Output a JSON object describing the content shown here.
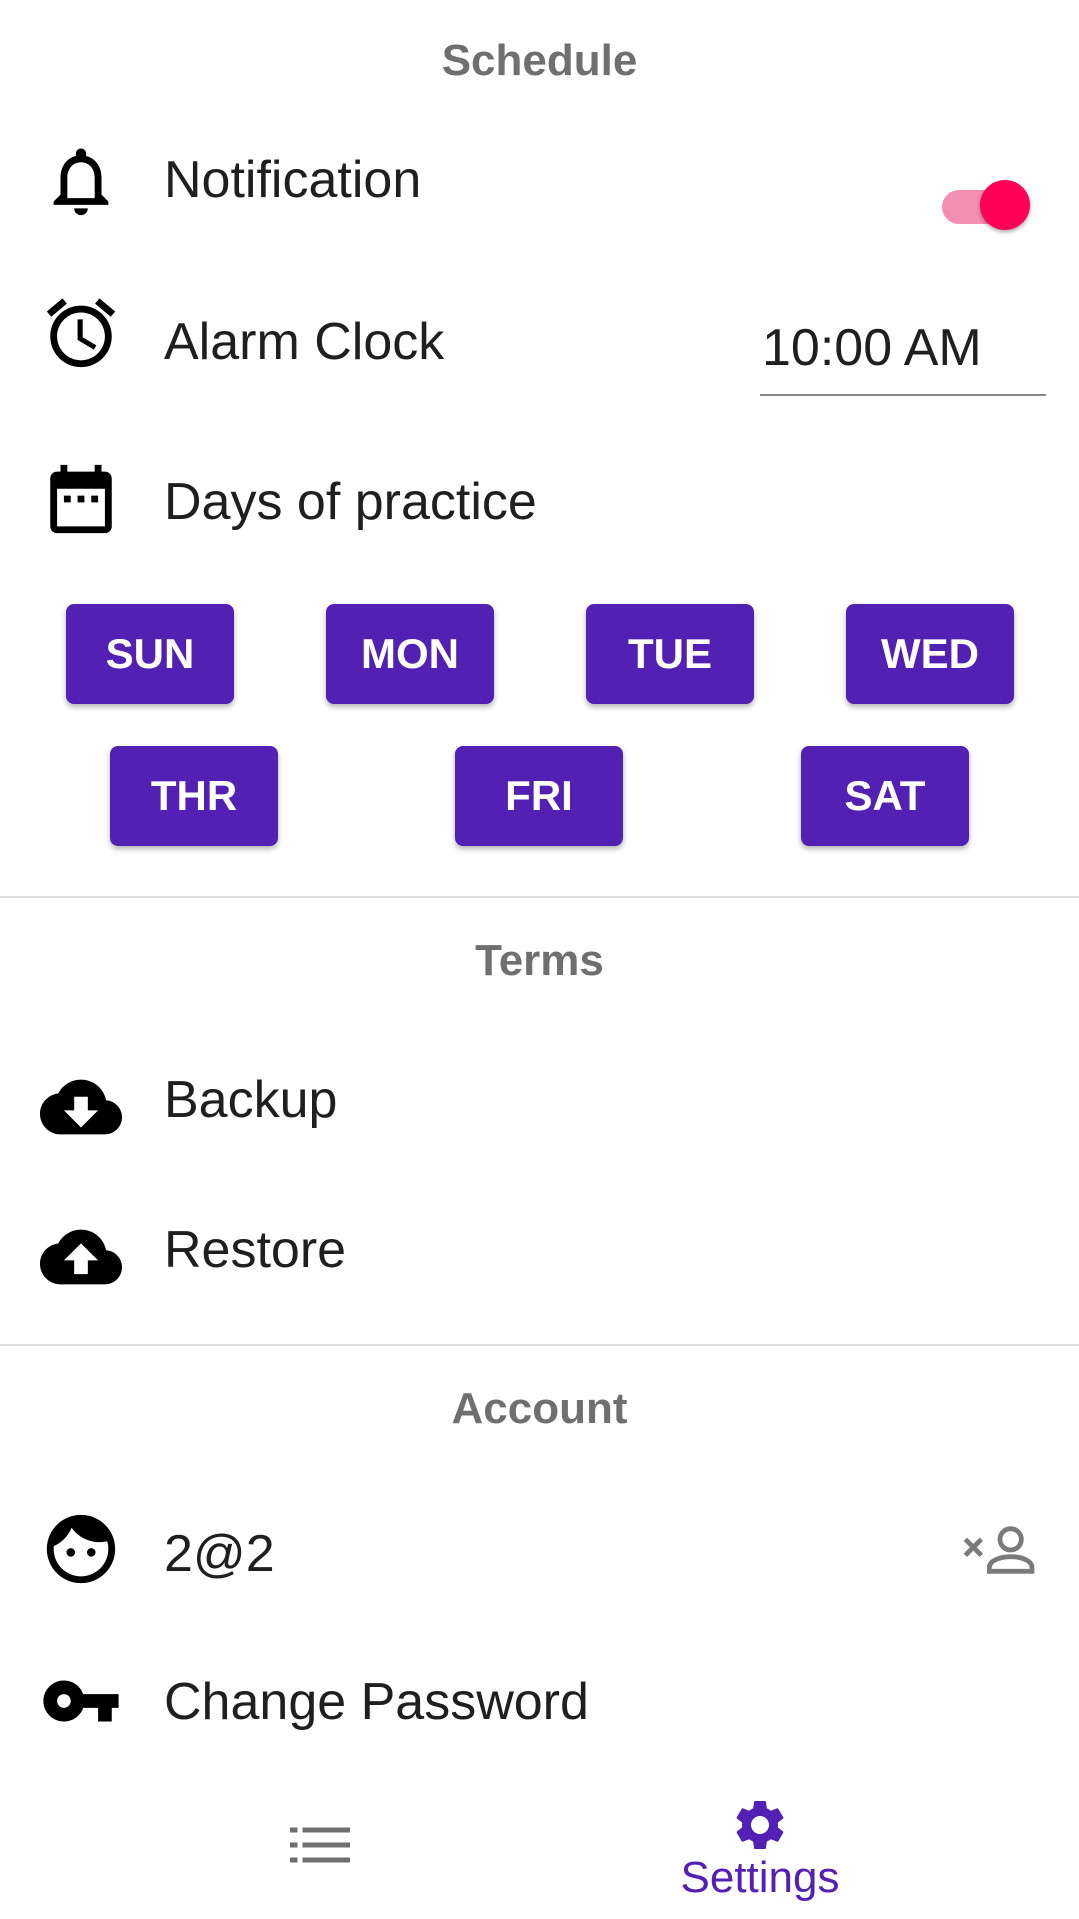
{
  "schedule": {
    "title": "Schedule",
    "notification_label": "Notification",
    "notification_on": true,
    "alarm_label": "Alarm Clock",
    "alarm_time": "10:00 AM",
    "days_label": "Days of practice",
    "days": [
      "SUN",
      "MON",
      "TUE",
      "WED",
      "THR",
      "FRI",
      "SAT"
    ]
  },
  "terms": {
    "title": "Terms",
    "backup_label": "Backup",
    "restore_label": "Restore"
  },
  "account": {
    "title": "Account",
    "user_label": "2@2",
    "change_password_label": "Change Password"
  },
  "bottom_nav": {
    "settings_label": "Settings"
  },
  "colors": {
    "accent": "#5320B4",
    "toggle_thumb": "#FF0057",
    "toggle_track": "#F48FB1"
  },
  "icons": {
    "notification": "bell-icon",
    "alarm": "alarm-clock-icon",
    "days": "calendar-icon",
    "backup": "cloud-download-icon",
    "restore": "cloud-upload-icon",
    "user": "face-icon",
    "remove_user": "remove-user-icon",
    "change_password": "key-icon",
    "nav_list": "list-icon",
    "nav_settings": "gear-icon"
  }
}
